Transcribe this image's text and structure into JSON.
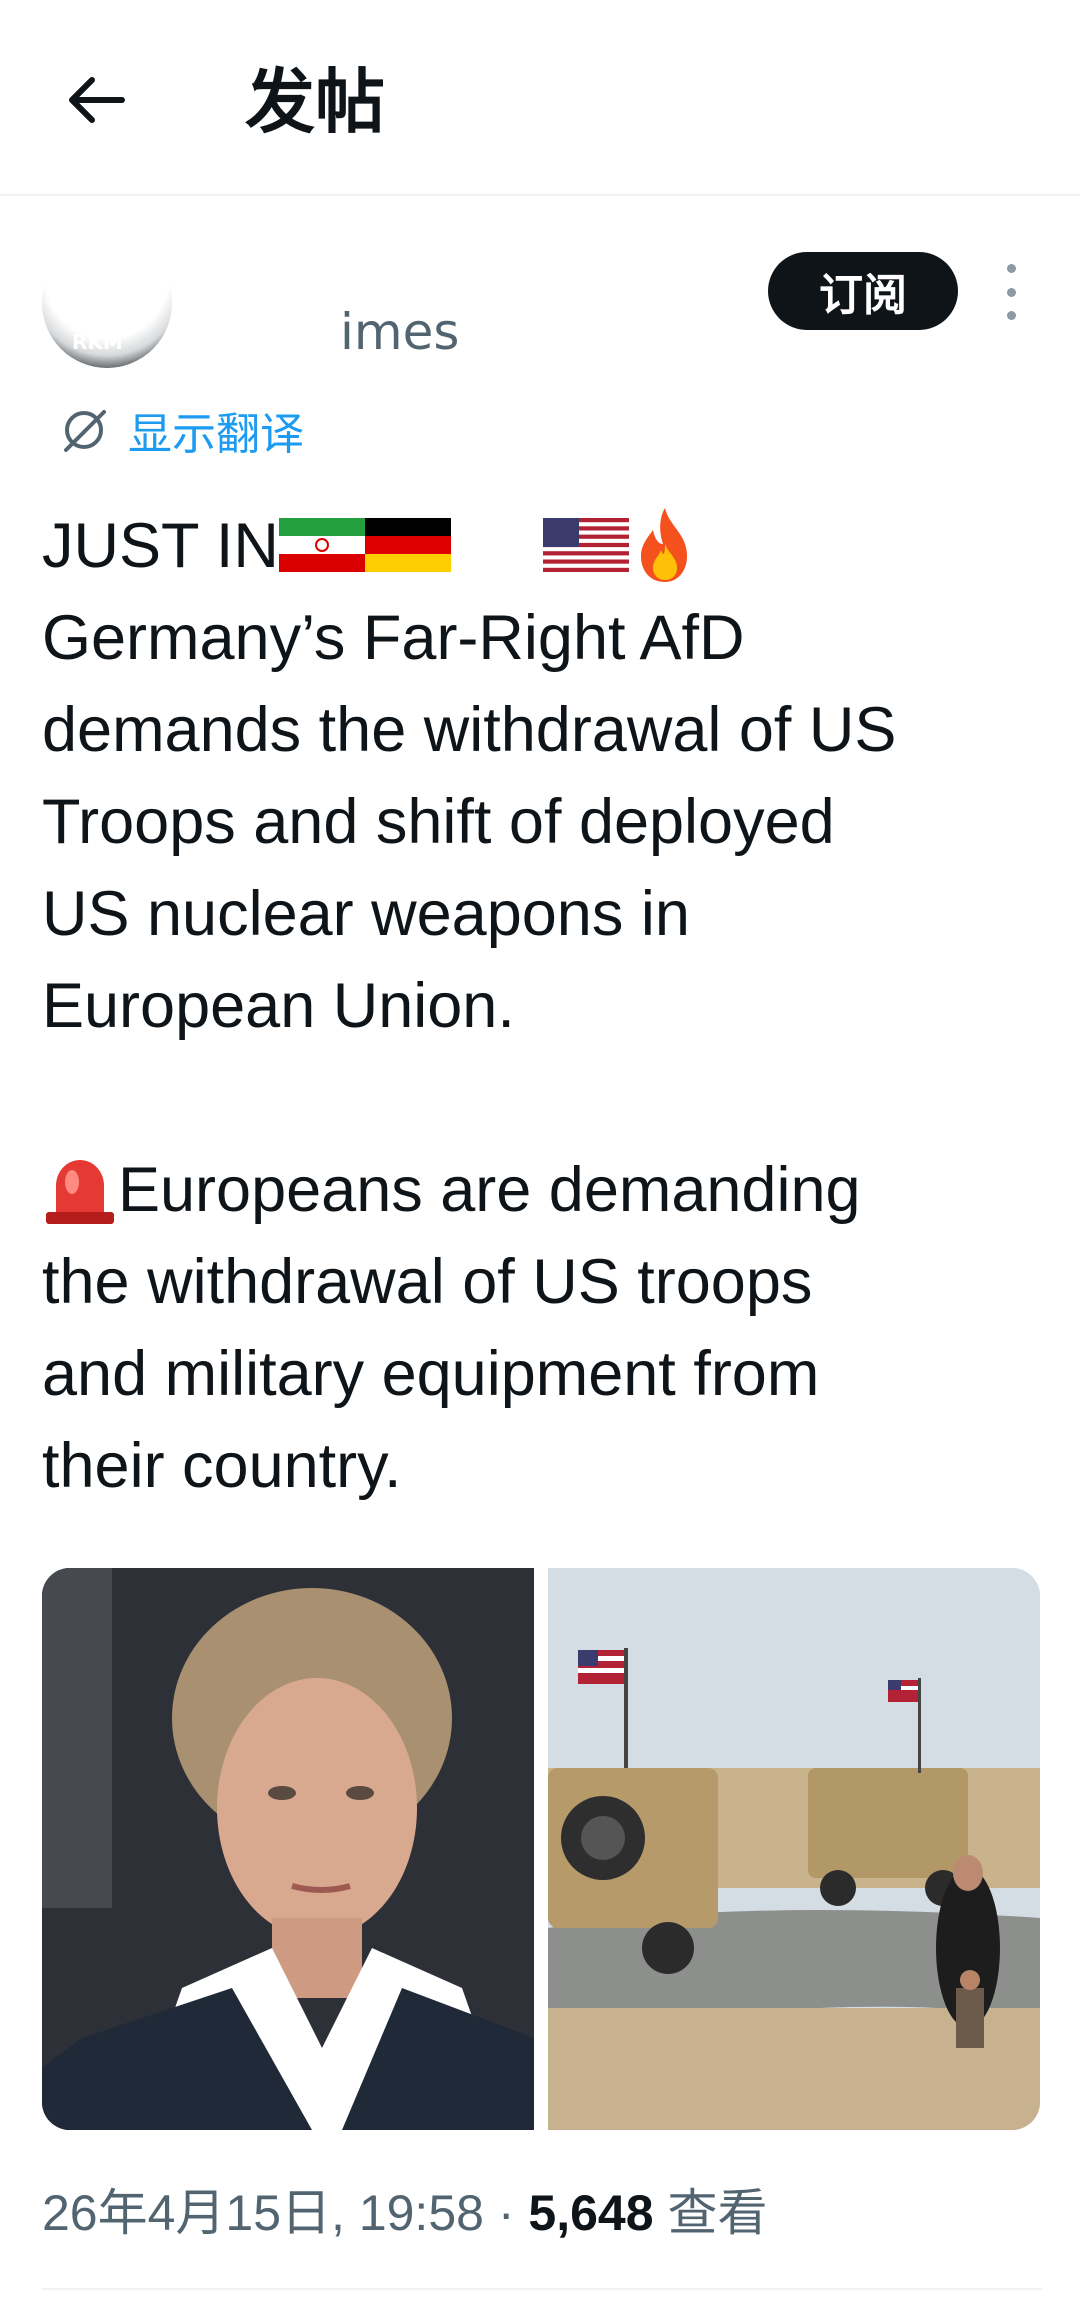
{
  "appbar": {
    "title": "发帖"
  },
  "author": {
    "name": "",
    "handle": "imes",
    "avatar_text": "RKM"
  },
  "actions": {
    "subscribe_label": "订阅"
  },
  "translate": {
    "label": "显示翻译"
  },
  "post": {
    "lines": [
      "JUST IN",
      "Germany’s Far-Right AfD",
      "demands the withdrawal of US",
      "Troops and shift of deployed",
      "US nuclear weapons in",
      "European Union.",
      "Europeans are demanding",
      "the withdrawal of US troops",
      "and military equipment from",
      "their country."
    ]
  },
  "meta": {
    "timestamp": "26年4月15日, 19:58",
    "separator": "·",
    "views_count": "5,648",
    "views_label": "查看"
  },
  "colors": {
    "accent": "#1d9bf0",
    "text": "#0f1419",
    "secondary": "#536471",
    "button_bg": "#0f1419"
  }
}
